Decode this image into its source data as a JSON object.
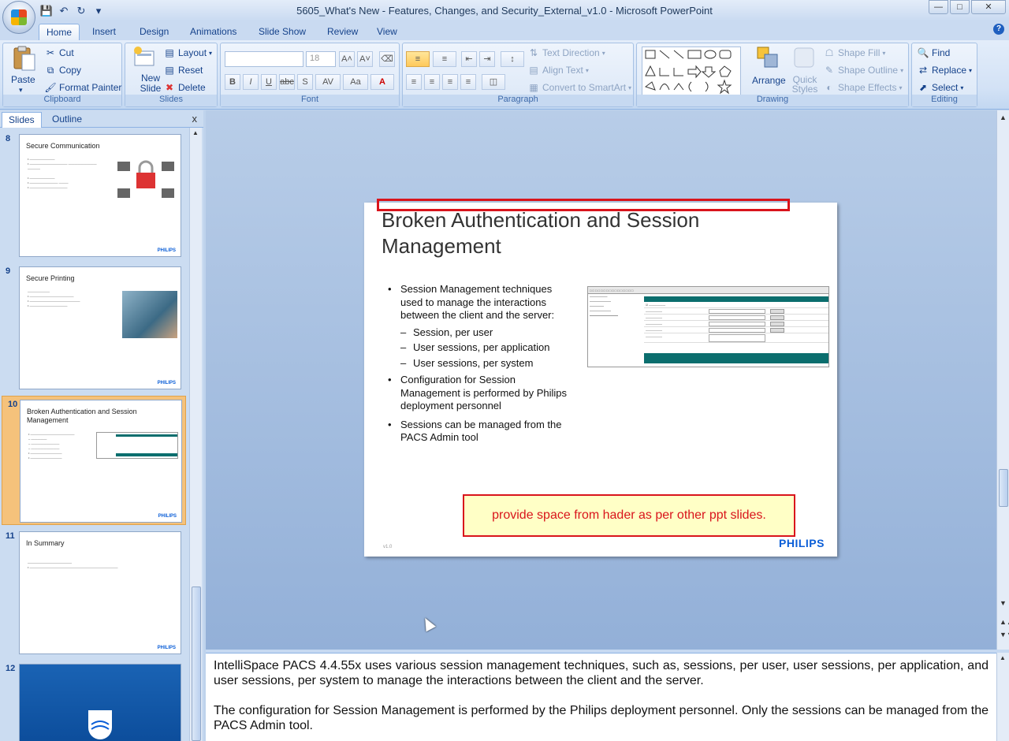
{
  "window": {
    "title": "5605_What's New - Features, Changes, and Security_External_v1.0 - Microsoft PowerPoint",
    "buttons": [
      "minimize",
      "maximize",
      "close"
    ]
  },
  "qat": {
    "icons": [
      "save-icon",
      "undo-icon",
      "redo-icon",
      "customize-icon"
    ]
  },
  "tabs": [
    "Home",
    "Insert",
    "Design",
    "Animations",
    "Slide Show",
    "Review",
    "View"
  ],
  "ribbon": {
    "clipboard": {
      "label": "Clipboard",
      "paste": "Paste",
      "cut": "Cut",
      "copy": "Copy",
      "format_painter": "Format Painter"
    },
    "slides": {
      "label": "Slides",
      "new_slide": "New Slide",
      "layout": "Layout",
      "reset": "Reset",
      "delete": "Delete"
    },
    "font": {
      "label": "Font",
      "font_name": "",
      "font_size": "18"
    },
    "paragraph": {
      "label": "Paragraph",
      "text_direction": "Text Direction",
      "align_text": "Align Text",
      "convert_smartart": "Convert to SmartArt"
    },
    "drawing": {
      "label": "Drawing",
      "arrange": "Arrange",
      "quick_styles": "Quick Styles",
      "shape_fill": "Shape Fill",
      "shape_outline": "Shape Outline",
      "shape_effects": "Shape Effects"
    },
    "editing": {
      "label": "Editing",
      "find": "Find",
      "replace": "Replace",
      "select": "Select"
    }
  },
  "pane": {
    "tab_slides": "Slides",
    "tab_outline": "Outline",
    "close": "x"
  },
  "thumbnails": [
    {
      "num": "8",
      "title": "Secure Communication"
    },
    {
      "num": "9",
      "title": "Secure Printing"
    },
    {
      "num": "10",
      "title": "Broken Authentication and Session Management"
    },
    {
      "num": "11",
      "title": "In Summary"
    },
    {
      "num": "12",
      "title": ""
    }
  ],
  "thumb_logo": "PHILIPS",
  "slide": {
    "title": "Broken Authentication and Session Management",
    "bullet1": "Session Management techniques used to manage the interactions between the client and the server:",
    "sub1": "Session, per user",
    "sub2": "User sessions, per application",
    "sub3": "User sessions, per system",
    "bullet2": "Configuration for Session Management is performed by Philips deployment personnel",
    "bullet3": "Sessions can be managed from the PACS Admin tool",
    "footer": "v1.0",
    "logo": "PHILIPS"
  },
  "annotation": {
    "note": "provide space from hader as per other ppt slides."
  },
  "notes": {
    "p1": "IntelliSpace PACS 4.4.55x uses various session management techniques, such as, sessions, per user, user sessions, per application, and user sessions, per system to manage the interactions between the client and the server.",
    "p2": "The configuration for Session Management is performed by the Philips deployment personnel. Only the sessions can be managed from the PACS Admin tool."
  }
}
